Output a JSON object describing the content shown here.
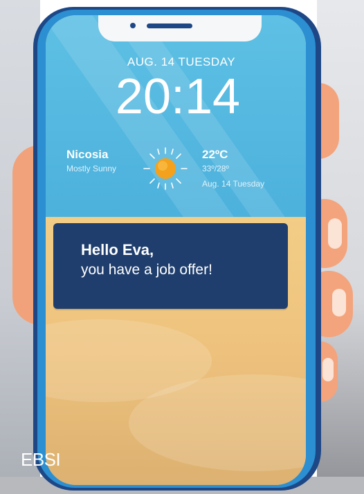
{
  "lockscreen": {
    "date": "AUG. 14 TUESDAY",
    "time": "20:14"
  },
  "weather": {
    "city": "Nicosia",
    "condition": "Mostly Sunny",
    "temperature": "22ºC",
    "range": "33º/28º",
    "date": "Aug. 14 Tuesday",
    "icon": "sun-icon"
  },
  "notification": {
    "greeting": "Hello Eva,",
    "message": "you have a job offer!"
  },
  "branding": {
    "watermark": "EBSI"
  },
  "colors": {
    "phone_body": "#1e4786",
    "screen_sky": "#4cb1dc",
    "screen_sand": "#eec27d",
    "notification_bg": "#1f3e6d",
    "sun": "#f4a11d",
    "hand": "#f2a27a"
  }
}
